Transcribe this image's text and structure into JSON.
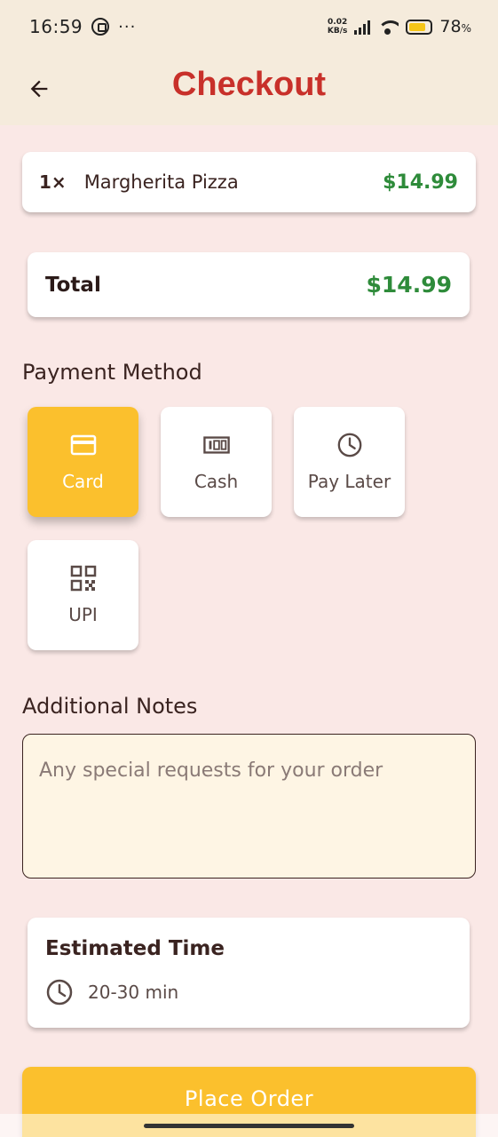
{
  "status_bar": {
    "time": "16:59",
    "overflow": "···",
    "net_speed_value": "0.02",
    "net_speed_unit": "KB/s",
    "battery_percent": "78",
    "battery_unit": "%",
    "battery_level": 0.78,
    "icons": [
      "whatsapp-icon",
      "signal-icon",
      "wifi-icon",
      "battery-icon"
    ]
  },
  "header": {
    "back_icon": "arrow-left-icon",
    "title": "Checkout",
    "title_color": "#c8302a"
  },
  "order_items": [
    {
      "qty": "1×",
      "name": "Margherita Pizza",
      "price": "$14.99"
    }
  ],
  "total": {
    "label": "Total",
    "value": "$14.99"
  },
  "payment": {
    "title": "Payment Method",
    "selected": "Card",
    "options": [
      {
        "label": "Card",
        "icon": "credit-card-icon"
      },
      {
        "label": "Cash",
        "icon": "cash-icon"
      },
      {
        "label": "Pay Later",
        "icon": "clock-icon"
      },
      {
        "label": "UPI",
        "icon": "qr-code-icon"
      }
    ]
  },
  "notes": {
    "title": "Additional Notes",
    "placeholder": "Any special requests for your order",
    "value": ""
  },
  "estimated_time": {
    "title": "Estimated Time",
    "icon": "clock-icon",
    "value": "20-30 min"
  },
  "actions": {
    "place_order": "Place Order"
  },
  "colors": {
    "accent": "#fbc02d",
    "price_green": "#2e8b3a",
    "background": "#fae8e6",
    "header_bg": "#f5ebdc"
  }
}
